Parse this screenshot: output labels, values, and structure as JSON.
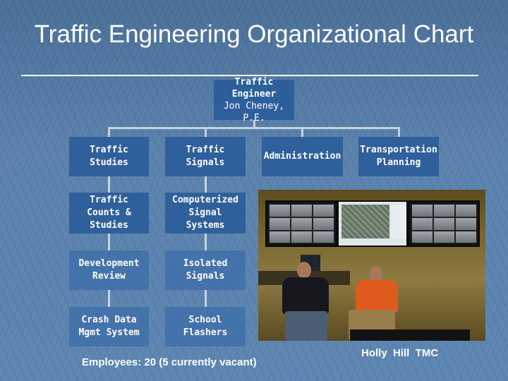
{
  "title": "Traffic Engineering Organizational Chart",
  "top_box": {
    "title_line1": "Traffic",
    "title_line2": "Engineer",
    "name": "Jon Cheney, P.E."
  },
  "divisions": [
    {
      "label": "Traffic Studies"
    },
    {
      "label": "Traffic Signals"
    },
    {
      "label": "Administration"
    },
    {
      "label": "Transportation Planning"
    }
  ],
  "studies_units": [
    {
      "label": "Traffic Counts & Studies"
    },
    {
      "label": "Development Review"
    },
    {
      "label": "Crash Data Mgmt System"
    }
  ],
  "signals_units": [
    {
      "label": "Computerized Signal Systems"
    },
    {
      "label": "Isolated Signals"
    },
    {
      "label": "School Flashers"
    }
  ],
  "employees_text": "Employees: 20  (5 currently vacant)",
  "photo": {
    "description": "Traffic management center with wall-mounted camera monitors and two staff seated",
    "caption": "Holly  Hill  TMC"
  },
  "colors": {
    "background": "#5a82ad",
    "box_solid": "#2f609b",
    "connector": "#c8d2de",
    "text": "#ffffff"
  }
}
